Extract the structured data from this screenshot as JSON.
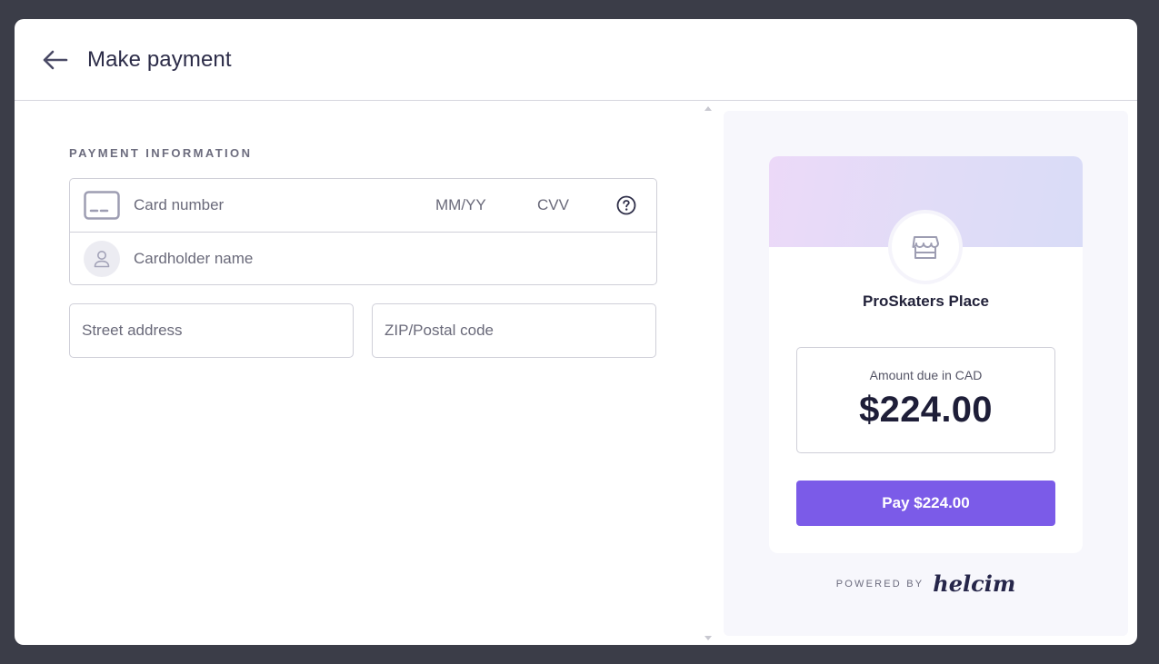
{
  "header": {
    "title": "Make payment"
  },
  "payment": {
    "section_label": "PAYMENT INFORMATION",
    "card_number_placeholder": "Card number",
    "expiry_placeholder": "MM/YY",
    "cvv_placeholder": "CVV",
    "cardholder_placeholder": "Cardholder name",
    "street_placeholder": "Street address",
    "zip_placeholder": "ZIP/Postal code"
  },
  "merchant": {
    "name": "ProSkaters Place",
    "amount_label": "Amount due in CAD",
    "amount": "$224.00",
    "pay_button": "Pay $224.00"
  },
  "footer": {
    "powered_by": "POWERED BY",
    "brand": "helcim"
  },
  "colors": {
    "accent": "#7b5be8",
    "backdrop": "#3b3d48"
  }
}
